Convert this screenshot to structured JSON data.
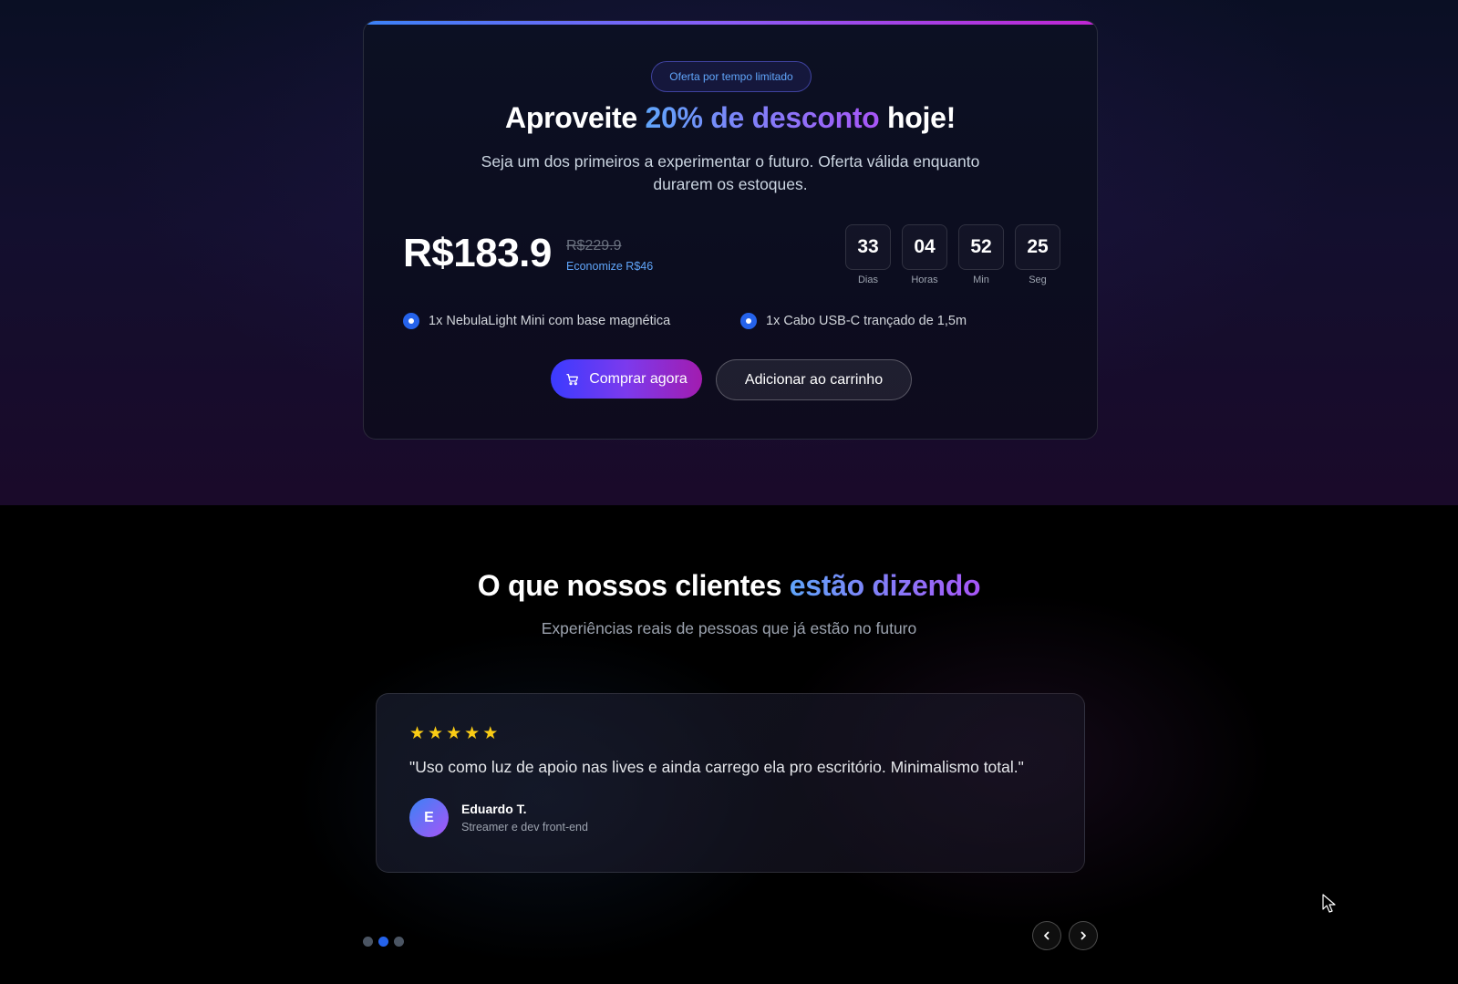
{
  "offer": {
    "badge": "Oferta por tempo limitado",
    "title_prefix": "Aproveite ",
    "title_highlight": "20% de desconto",
    "title_suffix": " hoje!",
    "subtitle": "Seja um dos primeiros a experimentar o futuro. Oferta válida enquanto durarem os estoques.",
    "price": "R$183.9",
    "old_price": "R$229.9",
    "savings": "Economize R$46",
    "countdown": [
      {
        "value": "33",
        "label": "Dias"
      },
      {
        "value": "04",
        "label": "Horas"
      },
      {
        "value": "52",
        "label": "Min"
      },
      {
        "value": "25",
        "label": "Seg"
      }
    ],
    "features": [
      "1x NebulaLight Mini com base magnética",
      "1x Cabo USB-C trançado de 1,5m"
    ],
    "buy_label": "Comprar agora",
    "cart_label": "Adicionar ao carrinho"
  },
  "testimonials": {
    "title_prefix": "O que nossos clientes ",
    "title_highlight": "estão dizendo",
    "subtitle": "Experiências reais de pessoas que já estão no futuro",
    "rating": 5,
    "quote": "\"Uso como luz de apoio nas lives e ainda carrego ela pro escritório. Minimalismo total.\"",
    "avatar_initial": "E",
    "author_name": "Eduardo T.",
    "author_role": "Streamer e dev front-end",
    "pages": 3,
    "active_page": 1,
    "prev_icon": "chevron-left-icon",
    "next_icon": "chevron-right-icon"
  },
  "colors": {
    "accent_blue": "#3b82f6",
    "accent_purple": "#a855f7",
    "star": "#facc15"
  }
}
